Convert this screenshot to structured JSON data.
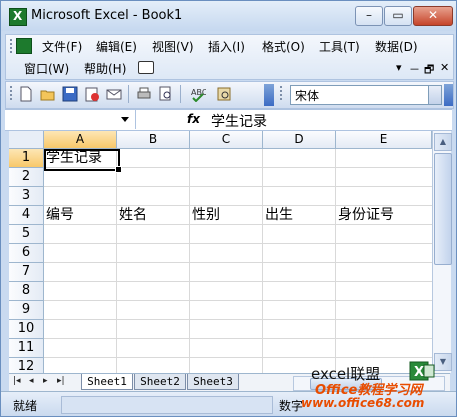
{
  "window": {
    "title": "Microsoft Excel - Book1",
    "app_icon_letter": "X",
    "minimize": "–",
    "restore": "▭",
    "close": "✕"
  },
  "menu": {
    "row1": [
      "文件(F)",
      "编辑(E)",
      "视图(V)",
      "插入(I)",
      "格式(O)",
      "工具(T)",
      "数据(D)"
    ],
    "row2": [
      "窗口(W)",
      "帮助(H)"
    ],
    "mdi_controls": [
      "▾",
      "－",
      "🗗",
      "✕"
    ]
  },
  "toolbar": {
    "icons": [
      "new-icon",
      "open-icon",
      "save-icon",
      "permission-icon",
      "email-icon",
      "print-icon",
      "print-preview-icon",
      "spelling-icon",
      "research-icon"
    ],
    "font_name": "宋体"
  },
  "formula_bar": {
    "name_box": "",
    "fx": "fx",
    "content": "学生记录"
  },
  "sheet": {
    "columns": [
      "A",
      "B",
      "C",
      "D",
      "E"
    ],
    "rows": [
      "1",
      "2",
      "3",
      "4",
      "5",
      "6",
      "7",
      "8",
      "9",
      "10",
      "11",
      "12"
    ],
    "active_cell": "A1",
    "cells": {
      "A1": "学生记录",
      "A4": "编号",
      "B4": "姓名",
      "C4": "性别",
      "D4": "出生",
      "E4": "身份证号"
    }
  },
  "tabs": {
    "sheets": [
      "Sheet1",
      "Sheet2",
      "Sheet3"
    ],
    "active": "Sheet1",
    "nav": [
      "|◂",
      "◂",
      "▸",
      "▸|"
    ]
  },
  "status": {
    "ready": "就绪",
    "mode": "数字"
  },
  "watermark": {
    "line1": "excel联盟",
    "line2": "Office教程学习网",
    "line3": "www.office68.com"
  },
  "colors": {
    "accent": "#c9daf0",
    "header_active": "#f8c86a",
    "watermark": "#e84c00"
  }
}
